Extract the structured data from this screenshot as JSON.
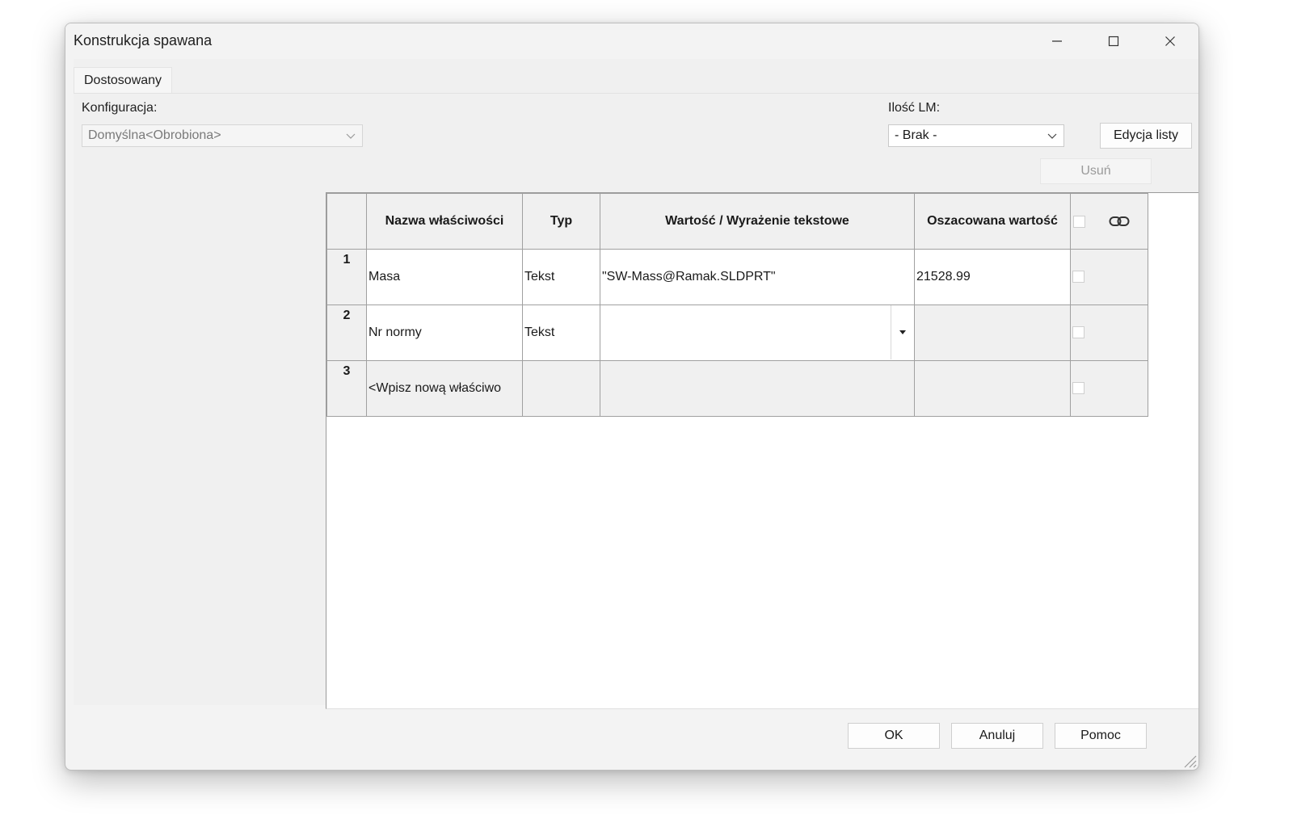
{
  "window": {
    "title": "Konstrukcja spawana",
    "controls": [
      "minimize-icon",
      "maximize-icon",
      "close-icon"
    ]
  },
  "tabs": [
    {
      "label": "Dostosowany",
      "selected": true
    }
  ],
  "config": {
    "label": "Konfiguracja:",
    "value": "Domyślna<Obrobiona>",
    "enabled": false
  },
  "bom": {
    "label": "Ilość LM:",
    "value": "- Brak -"
  },
  "buttons": {
    "edit_list": "Edycja listy",
    "delete": "Usuń",
    "ok": "OK",
    "cancel": "Anuluj",
    "help": "Pomoc"
  },
  "table": {
    "headers": {
      "name": "Nazwa właściwości",
      "type": "Typ",
      "value": "Wartość / Wyrażenie tekstowe",
      "evaluated": "Oszacowana wartość",
      "link_icon": "link-icon"
    },
    "rows": [
      {
        "num": "1",
        "name": "Masa",
        "type": "Tekst",
        "value": "\"SW-Mass@Ramak.SLDPRT\"",
        "evaluated": "21528.99"
      },
      {
        "num": "2",
        "name": "Nr normy",
        "type": "Tekst",
        "value": "",
        "evaluated": ""
      },
      {
        "num": "3",
        "name": "<Wpisz nową właściwo",
        "type": "",
        "value": "",
        "evaluated": ""
      }
    ]
  }
}
